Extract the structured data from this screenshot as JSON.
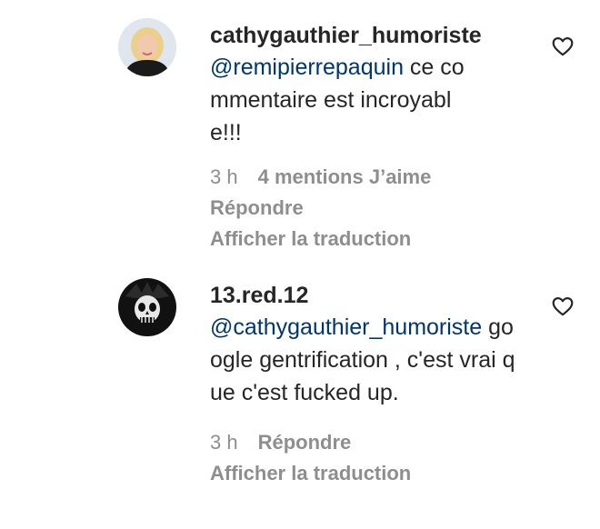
{
  "comments": [
    {
      "username": "cathygauthier_humoriste",
      "mention": "@remipierrepaquin",
      "text": " ce commentaire est incroyable!!!",
      "time": "3 h",
      "likes": "4 mentions J’aime",
      "reply": "Répondre",
      "translate": "Afficher la traduction"
    },
    {
      "username": "13.red.12",
      "mention": "@cathygauthier_humoriste",
      "text": " google gentrification , c'est vrai que c'est fucked up.",
      "time": "3 h",
      "reply": "Répondre",
      "translate": "Afficher la traduction"
    }
  ],
  "colors": {
    "text": "#262626",
    "mention": "#00376b",
    "secondary": "#8e8e8e"
  },
  "icons": [
    "avatar-blonde-woman",
    "avatar-skull",
    "heart-outline-icon"
  ]
}
